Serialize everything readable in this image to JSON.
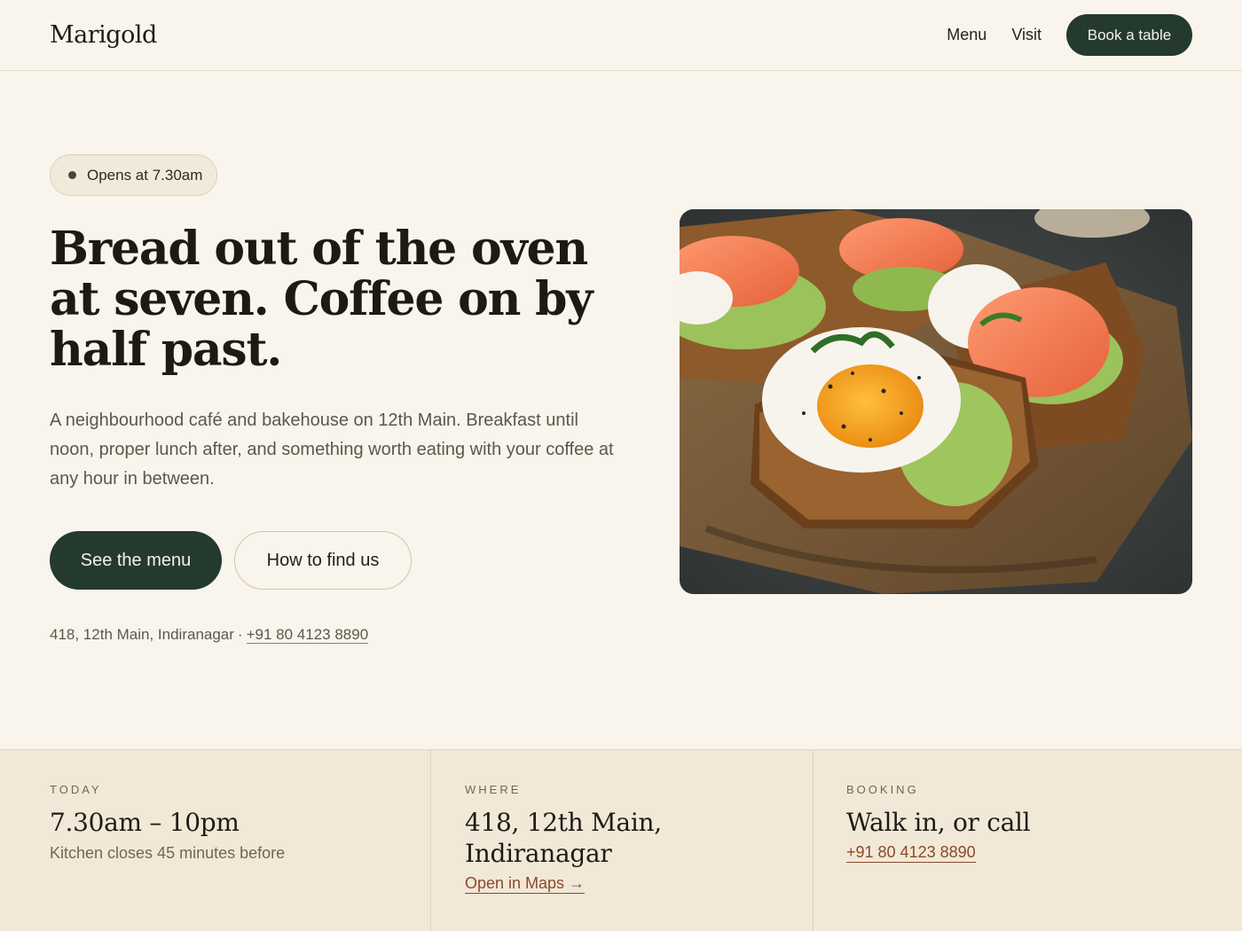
{
  "header": {
    "brand": "Marigold",
    "nav": [
      {
        "label": "Menu"
      },
      {
        "label": "Visit"
      }
    ],
    "cta_label": "Book a table"
  },
  "hero": {
    "status": "Opens at 7.30am",
    "headline": "Bread out of the oven at seven. Coffee on by half past.",
    "lede": "A neighbourhood café and bakehouse on 12th Main. Breakfast until noon, proper lunch after, and something worth eating with your coffee at any hour in between.",
    "primary_button": "See the menu",
    "secondary_button": "How to find us",
    "address": "418, 12th Main, Indiranagar",
    "separator": "·",
    "phone": "+91 80 4123 8890"
  },
  "info": {
    "today": {
      "eyebrow": "TODAY",
      "title": "7.30am – 10pm",
      "sub": "Kitchen closes 45 minutes before"
    },
    "where": {
      "eyebrow": "WHERE",
      "title": "418, 12th Main, Indiranagar",
      "link": "Open in Maps →"
    },
    "booking": {
      "eyebrow": "BOOKING",
      "title": "Walk in, or call",
      "link": "+91 80 4123 8890"
    }
  },
  "colors": {
    "background": "#f9f5ec",
    "accent_dark": "#253a2f",
    "band": "#f2e8d7",
    "link": "#8a4a2a"
  }
}
